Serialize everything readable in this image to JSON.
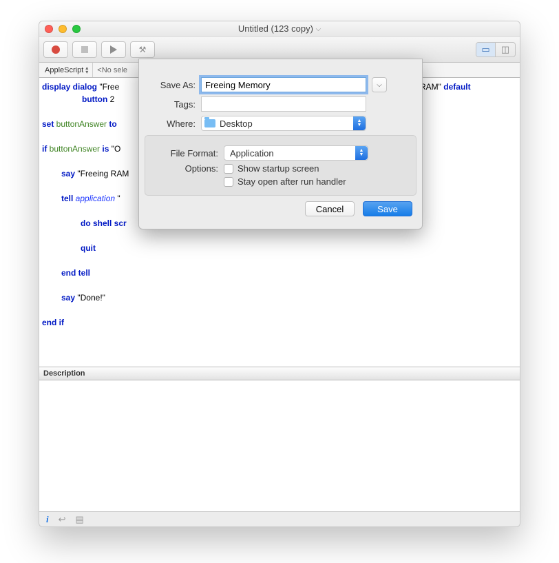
{
  "window": {
    "title": "Untitled (123 copy)"
  },
  "nav": {
    "language": "AppleScript",
    "selection": "<No sele"
  },
  "code": {
    "t_display_dialog": "display dialog",
    "t_str1_a": " \"Free",
    "t_str1_b": "g RAM\" ",
    "t_default": "default",
    "t_button": "button",
    "t_two": " 2",
    "t_set": "set",
    "t_ba": " buttonAnswer",
    "t_to": " to ",
    "t_if": "if",
    "t_ba2": " buttonAnswer",
    "t_is": " is ",
    "t_O": "\"O",
    "t_say": "say",
    "t_freeingram": " \"Freeing RAM",
    "t_tell": "tell",
    "t_app": " application",
    "t_q": " \"",
    "t_doshell": "do shell scr",
    "t_quit": "quit",
    "t_endtell": "end tell",
    "t_say2": "say",
    "t_done": " \"Done!\"",
    "t_endif": "end if"
  },
  "description_header": "Description",
  "sheet": {
    "save_as_label": "Save As:",
    "save_as_value": "Freeing Memory",
    "tags_label": "Tags:",
    "where_label": "Where:",
    "where_value": "Desktop",
    "file_format_label": "File Format:",
    "file_format_value": "Application",
    "options_label": "Options:",
    "opt_startup": "Show startup screen",
    "opt_stayopen": "Stay open after run handler",
    "cancel": "Cancel",
    "save": "Save"
  }
}
